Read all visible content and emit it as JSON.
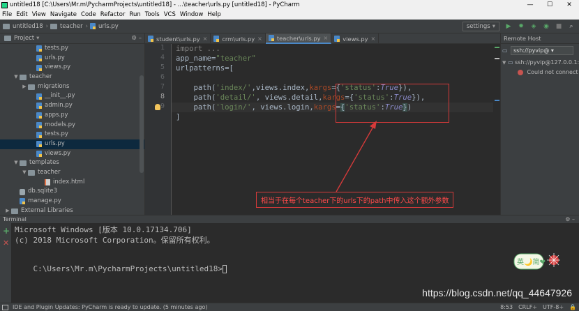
{
  "window": {
    "title": "untitled18 [C:\\Users\\Mr.m\\PycharmProjects\\untitled18] - ...\\teacher\\urls.py [untitled18] - PyCharm",
    "controls": [
      "—",
      "☐",
      "✕"
    ]
  },
  "menu": [
    "File",
    "Edit",
    "View",
    "Navigate",
    "Code",
    "Refactor",
    "Run",
    "Tools",
    "VCS",
    "Window",
    "Help"
  ],
  "breadcrumb": [
    "untitled18",
    "teacher",
    "urls.py"
  ],
  "toolbar": {
    "run_config": "settings",
    "buttons": [
      "run",
      "debug",
      "coverage",
      "profile",
      "stop",
      "search"
    ]
  },
  "project": {
    "header": "Project",
    "tree": [
      {
        "label": "tests.py",
        "kind": "py",
        "indent": 3
      },
      {
        "label": "urls.py",
        "kind": "py",
        "indent": 3
      },
      {
        "label": "views.py",
        "kind": "py",
        "indent": 3
      },
      {
        "label": "teacher",
        "kind": "folder",
        "indent": 1,
        "arrow": "▼"
      },
      {
        "label": "migrations",
        "kind": "folder",
        "indent": 2,
        "arrow": "▶"
      },
      {
        "label": "__init__.py",
        "kind": "py",
        "indent": 3
      },
      {
        "label": "admin.py",
        "kind": "py",
        "indent": 3
      },
      {
        "label": "apps.py",
        "kind": "py",
        "indent": 3
      },
      {
        "label": "models.py",
        "kind": "py",
        "indent": 3
      },
      {
        "label": "tests.py",
        "kind": "py",
        "indent": 3
      },
      {
        "label": "urls.py",
        "kind": "py",
        "indent": 3,
        "selected": true
      },
      {
        "label": "views.py",
        "kind": "py",
        "indent": 3
      },
      {
        "label": "templates",
        "kind": "folder",
        "indent": 1,
        "arrow": "▼"
      },
      {
        "label": "teacher",
        "kind": "folder",
        "indent": 2,
        "arrow": "▼"
      },
      {
        "label": "index.html",
        "kind": "html",
        "indent": 4
      },
      {
        "label": "db.sqlite3",
        "kind": "db",
        "indent": 1
      },
      {
        "label": "manage.py",
        "kind": "py",
        "indent": 1
      },
      {
        "label": "External Libraries",
        "kind": "folder",
        "indent": 0,
        "arrow": "▶"
      }
    ]
  },
  "tabs": [
    {
      "label": "student\\urls.py",
      "active": false
    },
    {
      "label": "crm\\urls.py",
      "active": false
    },
    {
      "label": "teacher\\urls.py",
      "active": true
    },
    {
      "label": "views.py",
      "active": false
    }
  ],
  "editor": {
    "line_numbers": [
      "1",
      "4",
      "5",
      "6",
      "7",
      "8",
      "9"
    ],
    "current_line": "8",
    "lines": [
      [
        {
          "t": "import ...",
          "c": "cmt"
        }
      ],
      [
        {
          "t": "app_name",
          "c": ""
        },
        {
          "t": "=",
          "c": ""
        },
        {
          "t": "\"teacher\"",
          "c": "str"
        }
      ],
      [
        {
          "t": "urlpatterns",
          "c": ""
        },
        {
          "t": "=[",
          "c": ""
        }
      ],
      [
        {
          "t": "",
          "c": ""
        }
      ],
      [
        {
          "t": "    path(",
          "c": ""
        },
        {
          "t": "'index/'",
          "c": "str"
        },
        {
          "t": ",views.index,",
          "c": ""
        },
        {
          "t": "kargs",
          "c": "param"
        },
        {
          "t": "={",
          "c": ""
        },
        {
          "t": "'status'",
          "c": "str"
        },
        {
          "t": ":",
          "c": ""
        },
        {
          "t": "True",
          "c": "italic"
        },
        {
          "t": "}),",
          "c": ""
        }
      ],
      [
        {
          "t": "    path(",
          "c": ""
        },
        {
          "t": "'detail/'",
          "c": "str"
        },
        {
          "t": ", views.detail,",
          "c": ""
        },
        {
          "t": "kargs",
          "c": "param"
        },
        {
          "t": "={",
          "c": ""
        },
        {
          "t": "'status'",
          "c": "str"
        },
        {
          "t": ":",
          "c": ""
        },
        {
          "t": "True",
          "c": "italic"
        },
        {
          "t": "}),",
          "c": ""
        }
      ],
      [
        {
          "t": "    path(",
          "c": ""
        },
        {
          "t": "'login/'",
          "c": "str"
        },
        {
          "t": ", views.login,",
          "c": ""
        },
        {
          "t": "kargs",
          "c": "param"
        },
        {
          "t": "=",
          "c": ""
        },
        {
          "t": "{",
          "c": "brkhl"
        },
        {
          "t": "'status'",
          "c": "str"
        },
        {
          "t": ":",
          "c": ""
        },
        {
          "t": "True",
          "c": "italic"
        },
        {
          "t": "}",
          "c": "brkhl"
        },
        {
          "t": ")",
          "c": ""
        }
      ],
      [
        {
          "t": "]",
          "c": ""
        }
      ]
    ],
    "annotation": "相当于在每个teacher下的urls下的path中传入这个额外参数"
  },
  "remote": {
    "header": "Remote Host",
    "combo": "ssh://pyvip@ ▾",
    "host": "ssh://pyvip@127.0.0.1:",
    "status": "Could not connect"
  },
  "terminal": {
    "header": "Terminal",
    "lines": [
      "Microsoft Windows [版本 10.0.17134.706]",
      "(c) 2018 Microsoft Corporation。保留所有权利。",
      "",
      "C:\\Users\\Mr.m\\PycharmProjects\\untitled18>"
    ],
    "watermark": "https://blog.csdn.net/qq_44647926",
    "sticker_text": "英🌙简❤"
  },
  "status": {
    "message": "IDE and Plugin Updates: PyCharm is ready to update. (5 minutes ago)",
    "position": "8:53",
    "line_sep": "CRLF÷",
    "encoding": "UTF-8÷"
  },
  "colors": {
    "editor_bg": "#2b2b2b",
    "panel_bg": "#3c3f41",
    "annotation_red": "#d53a3a",
    "selection": "#0d293e"
  }
}
